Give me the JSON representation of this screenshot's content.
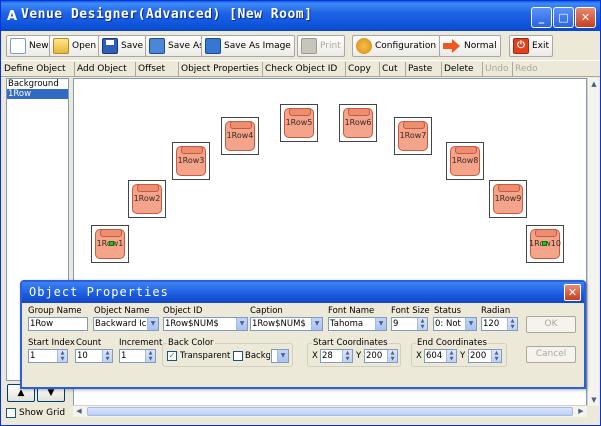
{
  "window": {
    "title": "Venue Designer(Advanced)  [New Room]",
    "app_icon": "app-icon"
  },
  "toolbar": {
    "new": "New",
    "open": "Open",
    "save": "Save",
    "save_as": "Save As",
    "save_as_image": "Save As Image",
    "print": "Print",
    "configuration": "Configuration",
    "normal": "Normal",
    "exit": "Exit"
  },
  "edit_toolbar": {
    "define_object": "Define Object",
    "add_object": "Add Object",
    "offset": "Offset",
    "object_properties": "Object Properties",
    "check_object_id": "Check Object ID",
    "copy": "Copy",
    "cut": "Cut",
    "paste": "Paste",
    "delete": "Delete",
    "undo": "Undo",
    "redo": "Redo"
  },
  "layers": [
    "Background",
    "1Row"
  ],
  "seats": [
    "1Row1",
    "1Row2",
    "1Row3",
    "1Row4",
    "1Row5",
    "1Row6",
    "1Row7",
    "1Row8",
    "1Row9",
    "1Row10"
  ],
  "left_controls": {
    "up_arrow": "▲",
    "down_arrow": "▼",
    "show_grid": "Show Grid"
  },
  "properties": {
    "title": "Object Properties",
    "labels": {
      "group_name": "Group Name",
      "object_name": "Object Name",
      "object_id": "Object ID",
      "caption": "Caption",
      "font_name": "Font Name",
      "font_size": "Font Size",
      "status": "Status",
      "radian": "Radian",
      "start_index": "Start Index",
      "count": "Count",
      "increment": "Increment",
      "back_color": "Back Color",
      "transparent": "Transparent",
      "background": "Backgrou",
      "start_coordinates": "Start Coordinates",
      "end_coordinates": "End Coordinates",
      "x": "X",
      "y": "Y"
    },
    "values": {
      "group_name": "1Row",
      "object_name": "Backward Ic",
      "object_id": "1Row$NUM$",
      "caption": "1Row$NUM$",
      "font_name": "Tahoma",
      "font_size": "9",
      "status": "0: Not",
      "radian": "120",
      "start_index": "1",
      "count": "10",
      "increment": "1",
      "start_x": "28",
      "start_y": "200",
      "end_x": "604",
      "end_y": "200"
    },
    "buttons": {
      "ok": "OK",
      "cancel": "Cancel"
    }
  }
}
